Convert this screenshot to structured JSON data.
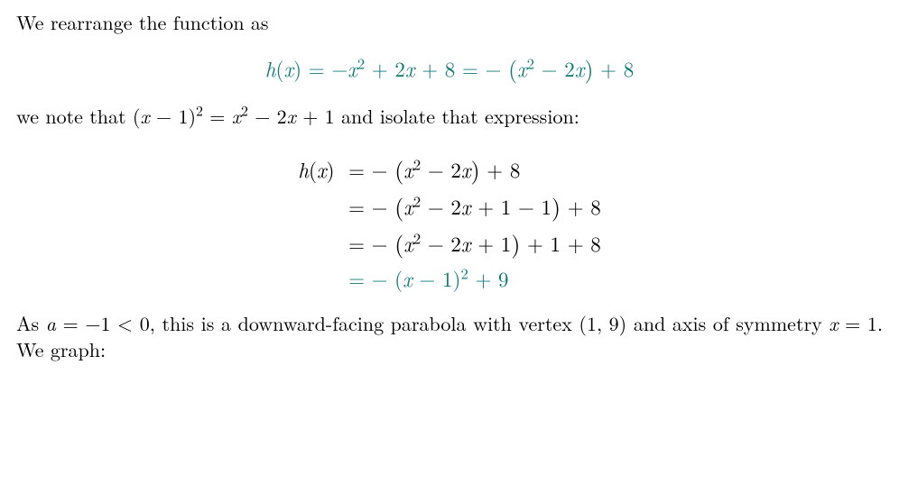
{
  "para1": "We rearrange the function as",
  "eq1": {
    "lhs": "h(x)",
    "mid": "−x² + 2x + 8",
    "rhs": "− (x² − 2x) + 8"
  },
  "para2_pre": "we note that ",
  "para2_math": "(x − 1)² = x² − 2x + 1",
  "para2_post": " and isolate that expression:",
  "align": {
    "lhs": "h(x)",
    "r1": "− (x² − 2x) + 8",
    "r2": "− (x² − 2x + 1 − 1) + 8",
    "r3": "− (x² − 2x + 1) + 1 + 8",
    "r4": "− (x − 1)² + 9"
  },
  "para3_pre": "As ",
  "para3_math1": "a = −1 < 0",
  "para3_mid": ", this is a downward-facing parabola with vertex ",
  "para3_math2": "(1, 9)",
  "para3_mid2": " and axis of symmetry ",
  "para3_math3": "x = 1",
  "para3_post": ". We graph:"
}
